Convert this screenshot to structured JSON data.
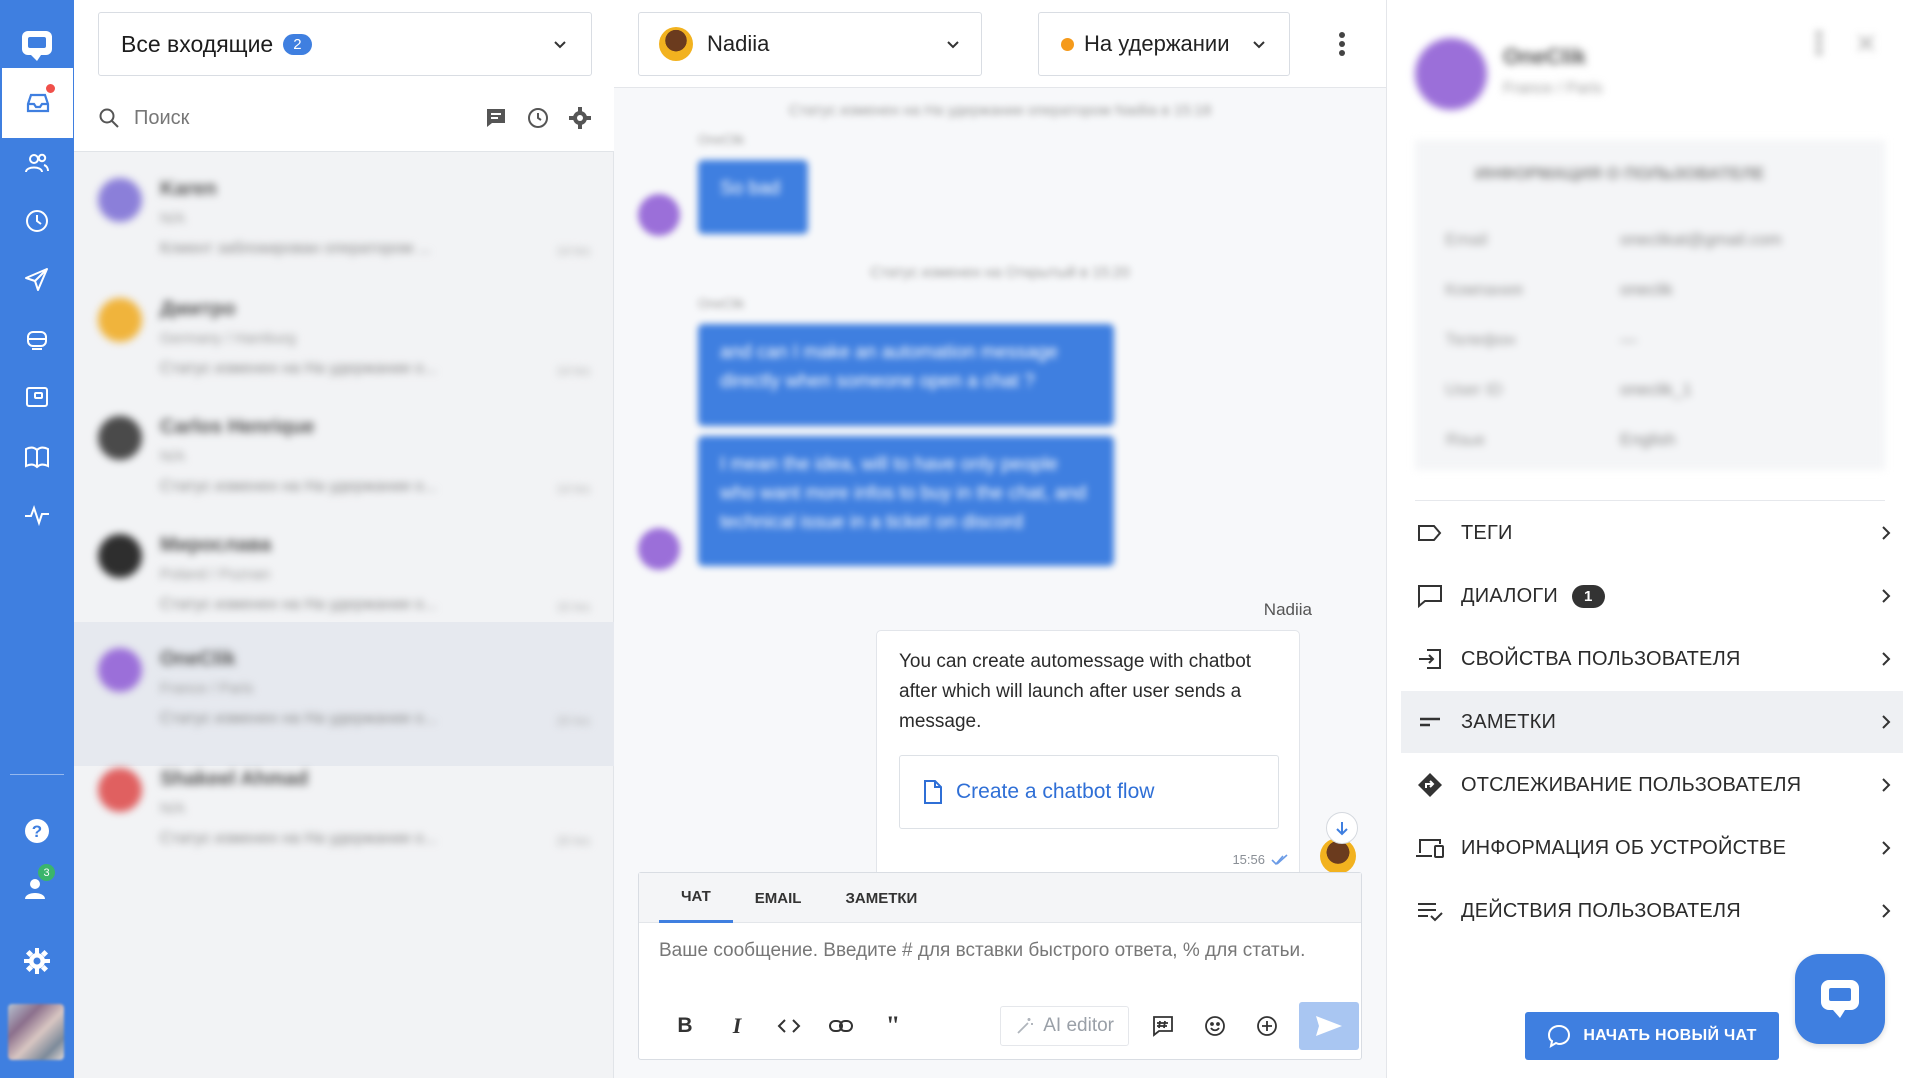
{
  "nav": {
    "items": [
      {
        "name": "inbox",
        "icon": "inbox-icon",
        "active": true,
        "has_dot": true
      },
      {
        "name": "contacts",
        "icon": "users-icon"
      },
      {
        "name": "history",
        "icon": "clock-icon"
      },
      {
        "name": "campaigns",
        "icon": "send-icon"
      },
      {
        "name": "chatbots",
        "icon": "robot-icon"
      },
      {
        "name": "widget",
        "icon": "widget-icon"
      },
      {
        "name": "knowledge-base",
        "icon": "book-icon"
      },
      {
        "name": "analytics",
        "icon": "pulse-icon"
      }
    ],
    "team_badge": "3"
  },
  "inbox": {
    "select_label": "Все входящие",
    "select_count": "2",
    "search_placeholder": "Поиск"
  },
  "conversations": [
    {
      "name": "Karen",
      "location": "N/A",
      "preview": "Клиент заблокирован оператором ...",
      "time": "14 hrs",
      "avatar_color": "#8b7fd9"
    },
    {
      "name": "Дмитро",
      "location": "Germany / Hamburg",
      "preview": "Статус изменен на На удержании о...",
      "time": "14 hrs",
      "avatar_color": "#f0b43c"
    },
    {
      "name": "Carlos Henrique",
      "location": "N/A",
      "preview": "Статус изменен на На удержании о...",
      "time": "14 hrs",
      "avatar_color": "#4a4a4a"
    },
    {
      "name": "Мирослава",
      "location": "Poland / Poznan",
      "preview": "Статус изменен на На удержании о...",
      "time": "15 hrs",
      "avatar_color": "#2e2e2e"
    },
    {
      "name": "OneClik",
      "location": "France / Paris",
      "preview": "Статус изменен на На удержании о...",
      "time": "20 hrs",
      "avatar_color": "#9b6fd9",
      "selected": true
    },
    {
      "name": "Shakeel Ahmad",
      "location": "N/A",
      "preview": "Статус изменен на На удержании о...",
      "time": "20 hrs",
      "avatar_color": "#e06060"
    }
  ],
  "chat": {
    "agent_name": "Nadiia",
    "status_label": "На удержании",
    "status_color": "#f59a1b",
    "history": {
      "system_1": "Статус изменен на На удержании оператором Nadiia в 15:18",
      "label_1": "OneClik",
      "bubble_1": "So bad",
      "system_2": "Статус изменен на Открытый в 15:20",
      "label_2": "OneClik",
      "bubble_2": "and can I make an automation message directly when someone open a chat ?",
      "bubble_3": "I mean the idea, will to have only people who want more infos to buy in the chat, and technical issue in a ticket on discord"
    },
    "sender": "Nadiia",
    "agent_message": "You can create automessage with chatbot after which will launch after user sends a message.",
    "cta_label": "Create a chatbot flow",
    "message_time": "15:56"
  },
  "composer": {
    "tabs": [
      "ЧАТ",
      "EMAIL",
      "ЗАМЕТКИ"
    ],
    "active_tab": 0,
    "placeholder": "Ваше сообщение. Введите # для вставки быстрого ответа, % для статьи.",
    "ai_editor_label": "AI editor"
  },
  "user_panel": {
    "name": "OneClik",
    "location": "France / Paris",
    "info_header": "ИНФОРМАЦИЯ О ПОЛЬЗОВАТЕЛЕ",
    "fields": [
      {
        "label": "Email",
        "value": "oneclikat@gmail.com"
      },
      {
        "label": "Компания",
        "value": "oneclik"
      },
      {
        "label": "Телефон",
        "value": "—"
      },
      {
        "label": "User ID",
        "value": "oneclik_1"
      },
      {
        "label": "Язык",
        "value": "English"
      }
    ],
    "sections": [
      {
        "label": "ТЕГИ",
        "icon": "tag-icon"
      },
      {
        "label": "ДИАЛОГИ",
        "icon": "chat-bubble-icon",
        "count": "1"
      },
      {
        "label": "СВОЙСТВА ПОЛЬЗОВАТЕЛЯ",
        "icon": "login-icon"
      },
      {
        "label": "ЗАМЕТКИ",
        "icon": "note-icon",
        "selected": true
      },
      {
        "label": "ОТСЛЕЖИВАНИЕ ПОЛЬЗОВАТЕЛЯ",
        "icon": "direction-icon"
      },
      {
        "label": "ИНФОРМАЦИЯ ОБ УСТРОЙСТВЕ",
        "icon": "devices-icon"
      },
      {
        "label": "ДЕЙСТВИЯ ПОЛЬЗОВАТЕЛЯ",
        "icon": "list-check-icon"
      }
    ],
    "new_chat_label": "НАЧАТЬ НОВЫЙ ЧАТ"
  },
  "colors": {
    "brand": "#3f7fe0",
    "bubble": "#3f7fe0",
    "link": "#2f6fd6"
  }
}
